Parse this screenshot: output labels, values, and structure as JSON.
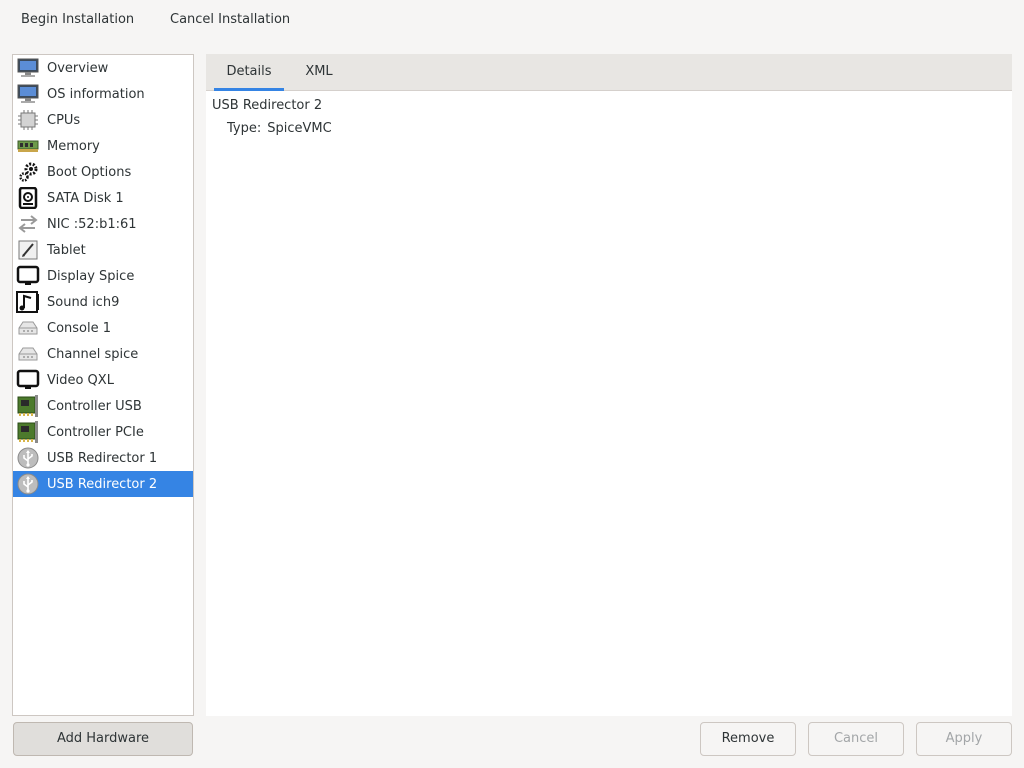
{
  "toolbar": {
    "begin_label": "Begin Installation",
    "cancel_label": "Cancel Installation"
  },
  "sidebar": {
    "items": [
      {
        "label": "Overview",
        "icon": "monitor-icon"
      },
      {
        "label": "OS information",
        "icon": "monitor-icon"
      },
      {
        "label": "CPUs",
        "icon": "cpu-chip-icon"
      },
      {
        "label": "Memory",
        "icon": "memory-module-icon"
      },
      {
        "label": "Boot Options",
        "icon": "gears-icon"
      },
      {
        "label": "SATA Disk 1",
        "icon": "hard-disk-icon"
      },
      {
        "label": "NIC :52:b1:61",
        "icon": "network-arrows-icon"
      },
      {
        "label": "Tablet",
        "icon": "tablet-pen-icon"
      },
      {
        "label": "Display Spice",
        "icon": "display-monitor-icon"
      },
      {
        "label": "Sound ich9",
        "icon": "sound-card-icon"
      },
      {
        "label": "Console 1",
        "icon": "serial-port-icon"
      },
      {
        "label": "Channel spice",
        "icon": "serial-port-icon"
      },
      {
        "label": "Video QXL",
        "icon": "display-monitor-icon"
      },
      {
        "label": "Controller USB",
        "icon": "pci-card-icon"
      },
      {
        "label": "Controller PCIe",
        "icon": "pci-card-icon"
      },
      {
        "label": "USB Redirector 1",
        "icon": "usb-icon"
      },
      {
        "label": "USB Redirector 2",
        "icon": "usb-icon"
      }
    ],
    "selected_index": 16,
    "add_label": "Add Hardware"
  },
  "tabs": [
    {
      "label": "Details",
      "active": true
    },
    {
      "label": "XML",
      "active": false
    }
  ],
  "details": {
    "title": "USB Redirector 2",
    "type_key": "Type:",
    "type_value": "SpiceVMC"
  },
  "buttons": {
    "remove": "Remove",
    "cancel": "Cancel",
    "apply": "Apply"
  },
  "colors": {
    "accent": "#3584e4",
    "window_bg": "#f6f5f4"
  }
}
